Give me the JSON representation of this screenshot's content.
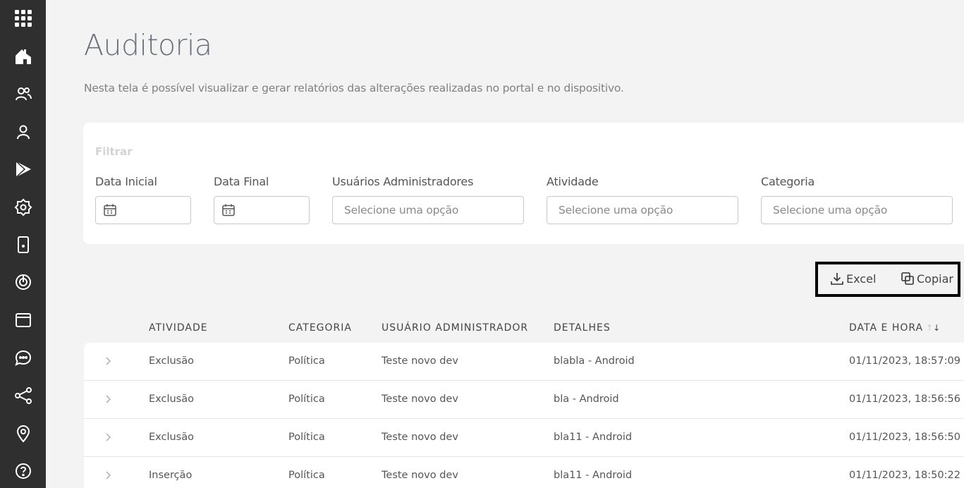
{
  "sidebar": {
    "items": [
      {
        "icon": "apps-grid-icon"
      },
      {
        "icon": "home-icon"
      },
      {
        "icon": "users-icon"
      },
      {
        "icon": "user-icon"
      },
      {
        "icon": "play-store-icon"
      },
      {
        "icon": "settings-icon"
      },
      {
        "icon": "device-icon"
      },
      {
        "icon": "target-icon"
      },
      {
        "icon": "window-icon"
      },
      {
        "icon": "chat-icon"
      },
      {
        "icon": "share-icon"
      },
      {
        "icon": "location-icon"
      },
      {
        "icon": "help-icon"
      }
    ],
    "colors": {
      "background": "#2f2f2f",
      "icon": "#ffffff"
    }
  },
  "page": {
    "title": "Auditoria",
    "description": "Nesta tela é possível visualizar e gerar relatórios das alterações realizadas no portal e no dispositivo."
  },
  "filter": {
    "title": "Filtrar",
    "fields": {
      "start_date": {
        "label": "Data Inicial",
        "value": ""
      },
      "end_date": {
        "label": "Data Final",
        "value": ""
      },
      "admins": {
        "label": "Usuários Administradores",
        "placeholder": "Selecione uma opção"
      },
      "activity": {
        "label": "Atividade",
        "placeholder": "Selecione uma opção"
      },
      "category": {
        "label": "Categoria",
        "placeholder": "Selecione uma opção"
      }
    }
  },
  "export": {
    "excel_label": "Excel",
    "copy_label": "Copiar"
  },
  "table": {
    "headers": {
      "activity": "ATIVIDADE",
      "category": "CATEGORIA",
      "admin": "USUÁRIO ADMINISTRADOR",
      "details": "DETALHES",
      "datetime": "DATA E HORA"
    },
    "sort": {
      "column": "datetime",
      "direction": "desc"
    },
    "rows": [
      {
        "activity": "Exclusão",
        "category": "Política",
        "admin": "Teste novo dev",
        "details": "blabla - Android",
        "datetime": "01/11/2023, 18:57:09"
      },
      {
        "activity": "Exclusão",
        "category": "Política",
        "admin": "Teste novo dev",
        "details": "bla - Android",
        "datetime": "01/11/2023, 18:56:56"
      },
      {
        "activity": "Exclusão",
        "category": "Política",
        "admin": "Teste novo dev",
        "details": "bla11 - Android",
        "datetime": "01/11/2023, 18:56:50"
      },
      {
        "activity": "Inserção",
        "category": "Política",
        "admin": "Teste novo dev",
        "details": "bla11 - Android",
        "datetime": "01/11/2023, 18:50:22"
      }
    ]
  }
}
